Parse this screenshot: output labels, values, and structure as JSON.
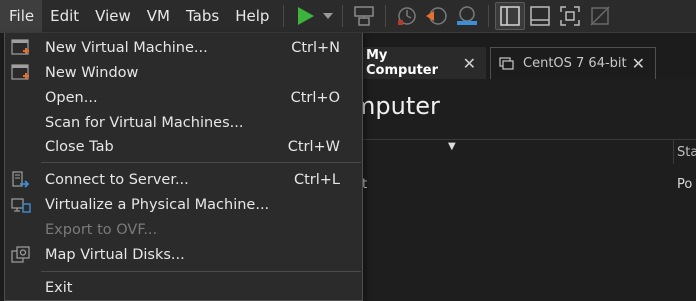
{
  "menubar": {
    "items": [
      {
        "label": "File"
      },
      {
        "label": "Edit"
      },
      {
        "label": "View"
      },
      {
        "label": "VM"
      },
      {
        "label": "Tabs"
      },
      {
        "label": "Help"
      }
    ],
    "toolbar_icons": [
      "play-icon",
      "dropdown-arrow-icon",
      "send-keys-icon",
      "snapshot-icon",
      "revert-snapshot-icon",
      "snapshot-manager-icon",
      "show-library-icon",
      "show-thumbnail-bar-icon",
      "full-screen-icon",
      "unity-icon"
    ]
  },
  "tabs": [
    {
      "label": "My Computer",
      "active": true
    },
    {
      "label": "CentOS 7 64-bit",
      "active": false
    }
  ],
  "content": {
    "page_title": "mputer",
    "column_status": "Sta",
    "row_name": "t",
    "row_status": "Po"
  },
  "file_menu": {
    "items": [
      {
        "label": "New Virtual Machine...",
        "shortcut": "Ctrl+N",
        "icon": "new-vm-icon",
        "disabled": false
      },
      {
        "label": "New Window",
        "shortcut": "",
        "icon": "new-window-icon",
        "disabled": false
      },
      {
        "label": "Open...",
        "shortcut": "Ctrl+O",
        "icon": "",
        "disabled": false
      },
      {
        "label": "Scan for Virtual Machines...",
        "shortcut": "",
        "icon": "",
        "disabled": false
      },
      {
        "label": "Close Tab",
        "shortcut": "Ctrl+W",
        "icon": "",
        "disabled": false
      },
      {
        "label": "Connect to Server...",
        "shortcut": "Ctrl+L",
        "icon": "connect-server-icon",
        "disabled": false
      },
      {
        "label": "Virtualize a Physical Machine...",
        "shortcut": "",
        "icon": "virtualize-physical-icon",
        "disabled": false
      },
      {
        "label": "Export to OVF...",
        "shortcut": "",
        "icon": "",
        "disabled": true
      },
      {
        "label": "Map Virtual Disks...",
        "shortcut": "",
        "icon": "map-disks-icon",
        "disabled": false
      },
      {
        "label": "Exit",
        "shortcut": "",
        "icon": "",
        "disabled": false
      }
    ]
  },
  "colors": {
    "play_green": "#3db33d",
    "accent_orange": "#e8702a",
    "accent_blue": "#3c8fd6"
  }
}
